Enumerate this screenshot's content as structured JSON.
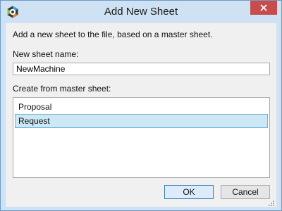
{
  "window": {
    "title": "Add New Sheet",
    "app_icon": "a-logo-icon",
    "close_icon": "close-icon"
  },
  "dialog": {
    "description": "Add a new sheet to the file, based on a master sheet.",
    "name_label": "New sheet name:",
    "name_value": "NewMachine",
    "master_label": "Create from master sheet:",
    "master_sheets": [
      {
        "label": "Proposal",
        "selected": false
      },
      {
        "label": "Request",
        "selected": true
      }
    ],
    "ok_label": "OK",
    "cancel_label": "Cancel"
  },
  "colors": {
    "titlebar": "#cfe2f3",
    "close_button": "#c74d4d",
    "selection_fill": "#cce8f4",
    "selection_border": "#6db4d8"
  }
}
